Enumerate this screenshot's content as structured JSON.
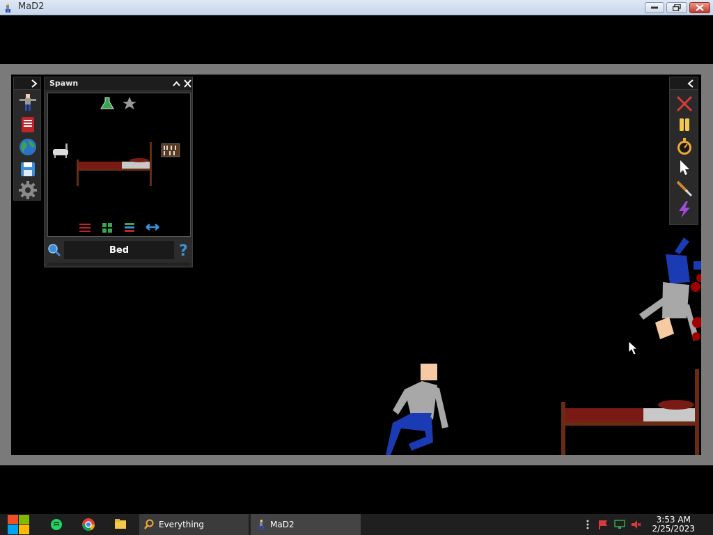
{
  "window": {
    "title": "MaD2",
    "buttons": [
      "minimize",
      "restore",
      "close"
    ]
  },
  "spawn_panel": {
    "title": "Spawn",
    "selected_item": "Bed",
    "category_icons": [
      "flask-icon",
      "star-icon"
    ],
    "items": [
      "bathtub-icon",
      "bed-icon",
      "bookshelf-icon"
    ],
    "view_icons": [
      "sliders-icon",
      "grid-icon",
      "list-icon",
      "swap-icon"
    ]
  },
  "left_toolbar": {
    "icons": [
      "ragdoll-pose-icon",
      "book-icon",
      "globe-icon",
      "save-icon",
      "gear-icon"
    ]
  },
  "right_toolbar": {
    "icons": [
      "close-x-icon",
      "pause-icon",
      "stopwatch-icon",
      "cursor-icon",
      "knife-icon",
      "lightning-icon"
    ]
  },
  "taskbar": {
    "items": [
      {
        "name": "Everything"
      },
      {
        "name": "MaD2"
      }
    ],
    "time": "3:53 AM",
    "date": "2/25/2023"
  },
  "colors": {
    "frame": "#7a7a7a",
    "stage": "#000000",
    "ragdoll_shirt": "#a8a8a8",
    "ragdoll_pants": "#1b3bb5",
    "ragdoll_skin": "#f6cba3",
    "bed_frame": "#6b2a14",
    "bed_blanket": "#7a1a14",
    "blood": "#a00000"
  }
}
